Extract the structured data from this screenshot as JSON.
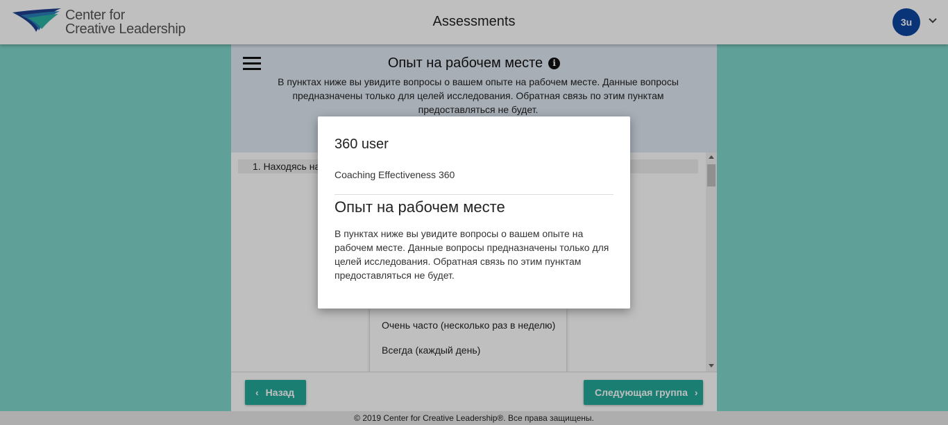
{
  "header": {
    "logo_line1": "Center for",
    "logo_line2": "Creative Leadership",
    "title": "Assessments",
    "avatar_initials": "3u",
    "avatar_color": "#0d47a1",
    "caret_icon": "chevron-down-icon"
  },
  "section": {
    "title": "Опыт на рабочем месте",
    "info_icon": "i",
    "description": "В пунктах ниже вы увидите вопросы о вашем опыте на рабочем месте. Данные вопросы предназначены только для целей исследования. Обратная связь по этим пунктам предоставляться не будет."
  },
  "question": {
    "text": "1. Находясь на"
  },
  "dropdown": {
    "options": [
      "Очень часто (несколько раз в неделю)",
      "Всегда (каждый день)"
    ]
  },
  "nav": {
    "back_label": "Назад",
    "next_label": "Следующая группа",
    "button_color": "#23a89a"
  },
  "footer": {
    "copyright": "© 2019 Center for Creative Leadership®. Все права защищены."
  },
  "modal": {
    "user": "360 user",
    "assessment": "Coaching Effectiveness 360",
    "title": "Опыт на рабочем месте",
    "description": "В пунктах ниже вы увидите вопросы о вашем опыте на рабочем месте. Данные вопросы предназначены только для целей исследования. Обратная связь по этим пунктам предоставляться не будет."
  }
}
